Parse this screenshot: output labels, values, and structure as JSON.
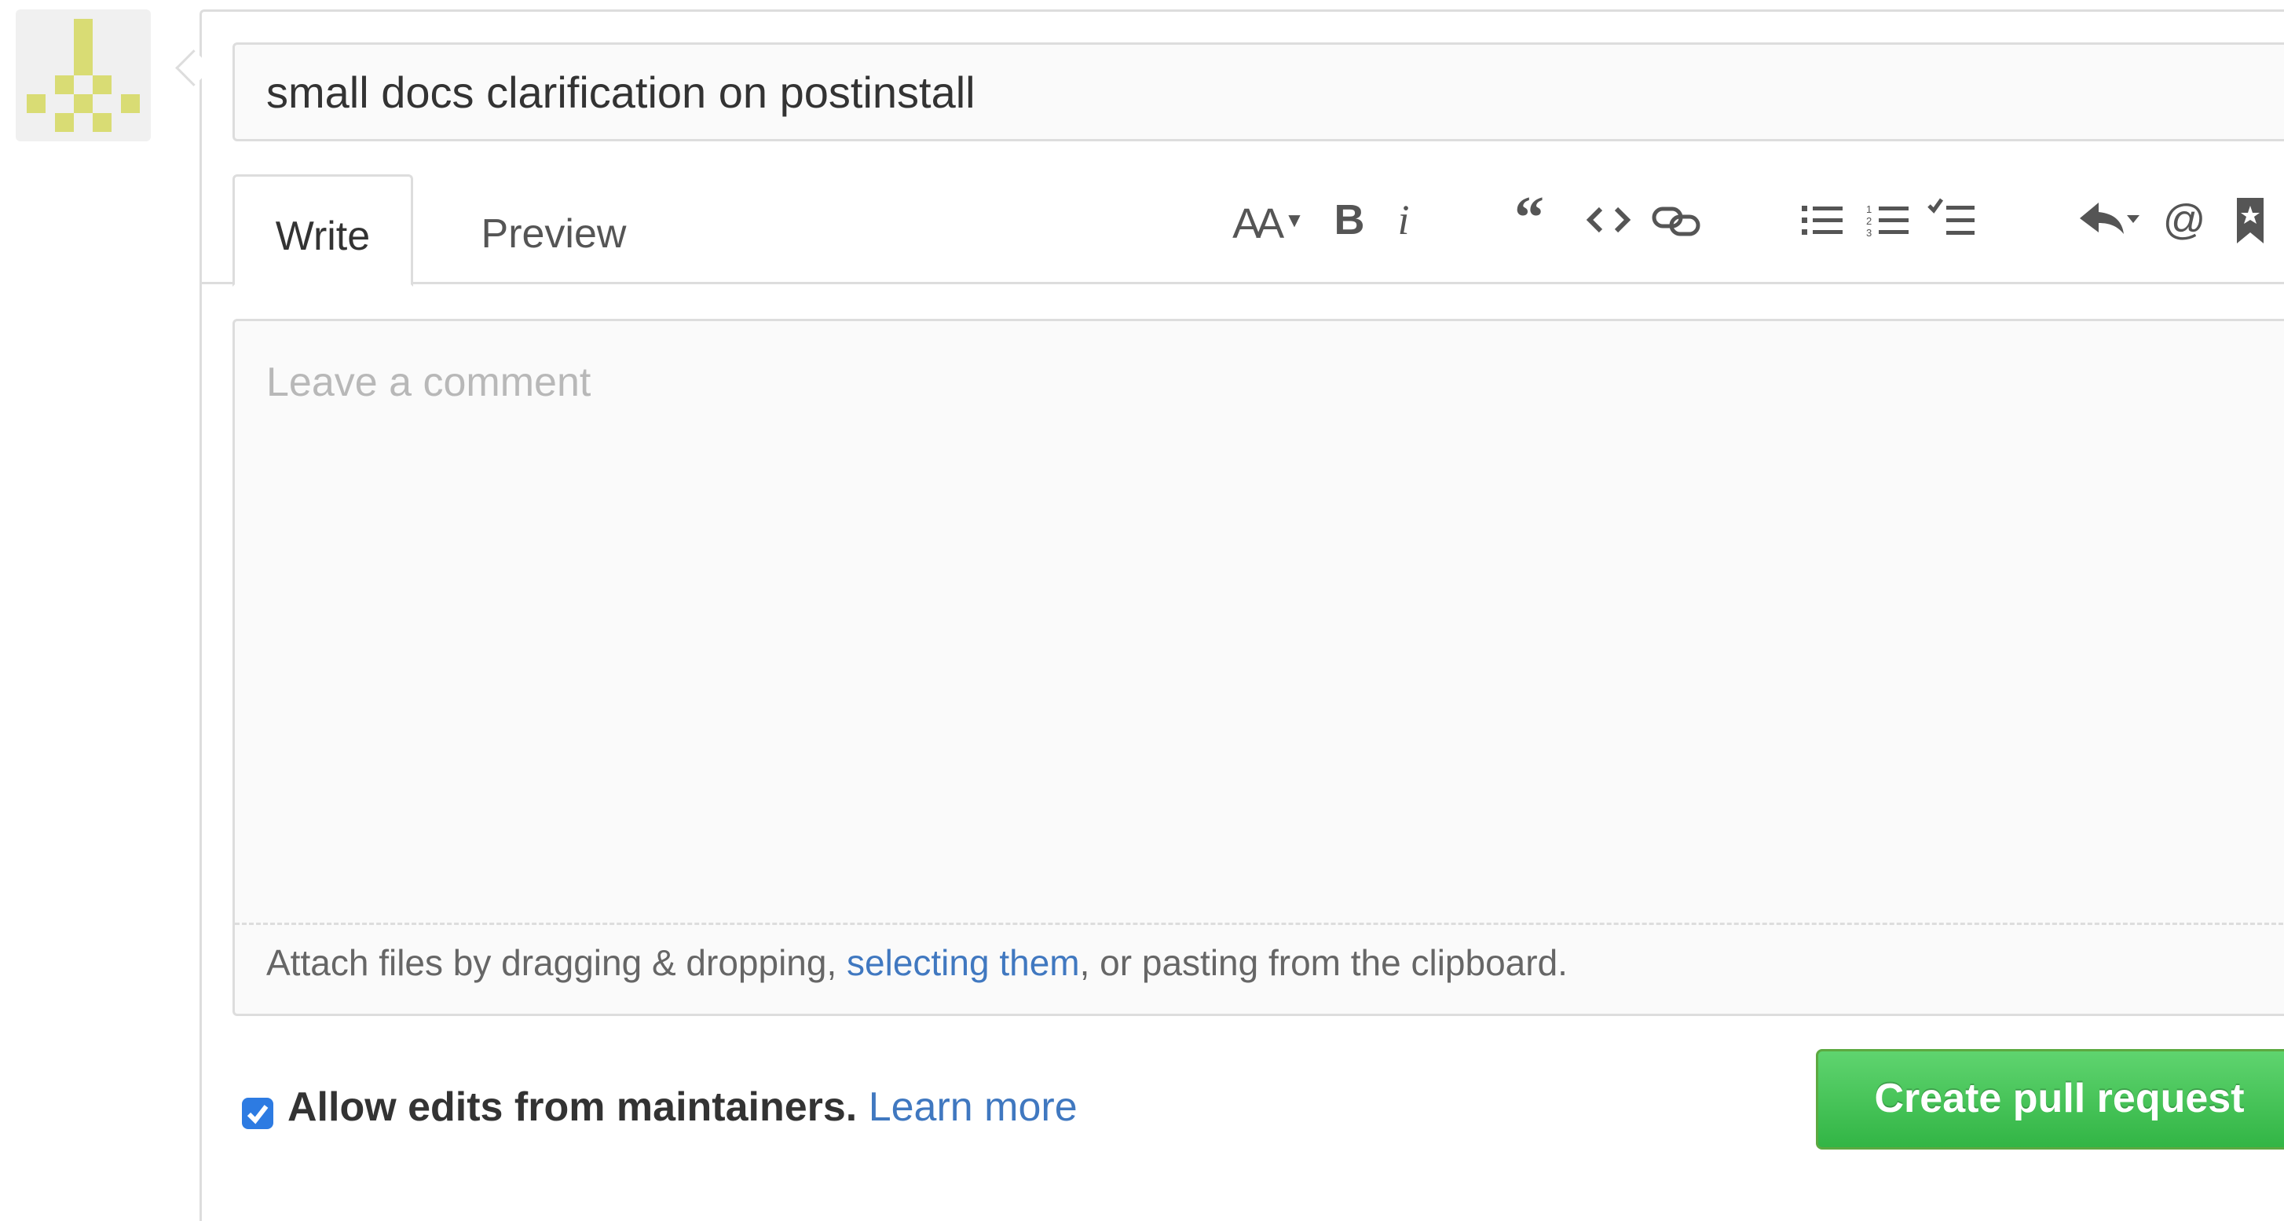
{
  "title_field": {
    "value": "small docs clarification on postinstall"
  },
  "tabs": [
    {
      "label": "Write",
      "active": true
    },
    {
      "label": "Preview",
      "active": false
    }
  ],
  "toolbar": {
    "header_label": "AA",
    "bold_label": "B",
    "italic_label": "i",
    "mention_label": "@",
    "icons": [
      "text-size-icon",
      "bold-icon",
      "italic-icon",
      "quote-icon",
      "code-icon",
      "link-icon",
      "bullet-list-icon",
      "numbered-list-icon",
      "task-list-icon",
      "reply-icon",
      "mention-icon",
      "bookmark-icon"
    ]
  },
  "comment": {
    "placeholder": "Leave a comment",
    "attach_prefix": "Attach files by dragging & dropping, ",
    "attach_link": "selecting them",
    "attach_suffix": ", or pasting from the clipboard."
  },
  "maintainers": {
    "checked": true,
    "label": "Allow edits from maintainers.",
    "link": "Learn more"
  },
  "submit": {
    "label": "Create pull request"
  },
  "colors": {
    "accent": "#4078c0",
    "button_green": "#32b545",
    "checkbox": "#2d7be2",
    "identicon": "#d9dc74"
  }
}
